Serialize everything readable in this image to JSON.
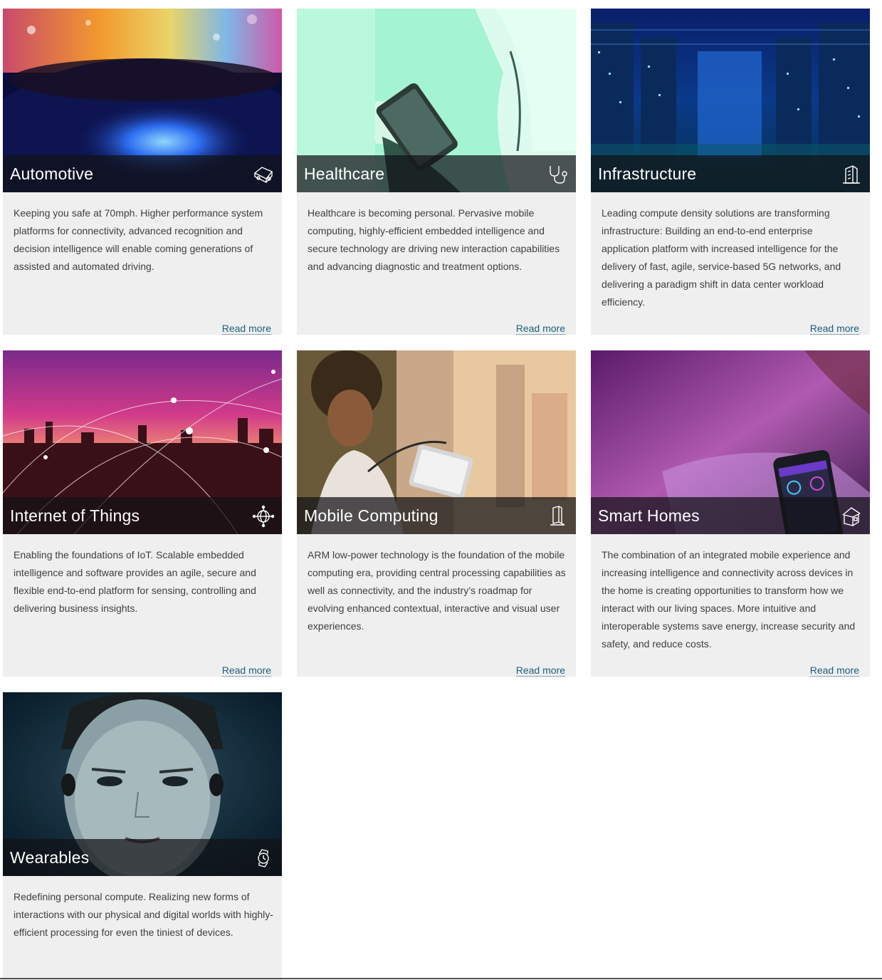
{
  "cards": [
    {
      "title": "Automotive",
      "description": "Keeping you safe at 70mph.  Higher performance system platforms for connectivity, advanced recognition and decision intelligence will enable coming generations of assisted and automated driving.",
      "link": "Read more",
      "icon": "car-icon"
    },
    {
      "title": "Healthcare",
      "description": "Healthcare is becoming personal. Pervasive mobile computing, highly-efficient embedded intelligence and secure technology are driving new interaction capabilities and advancing diagnostic and treatment options.",
      "link": "Read more",
      "icon": "stethoscope-icon"
    },
    {
      "title": "Infrastructure",
      "description": "Leading compute density solutions are transforming infrastructure: Building an end-to-end enterprise application platform with increased intelligence for the delivery of fast, agile, service-based 5G networks, and delivering a paradigm shift in data center workload efficiency.",
      "link": "Read more",
      "icon": "building-icon"
    },
    {
      "title": "Internet of Things",
      "description": "Enabling the foundations of IoT. Scalable embedded intelligence and software provides an agile, secure and flexible end-to-end platform for sensing, controlling and delivering business insights.",
      "link": "Read more",
      "icon": "globe-network-icon"
    },
    {
      "title": "Mobile Computing",
      "description": "ARM low-power technology is the foundation of the mobile computing era, providing central processing capabilities as well as connectivity, and the industry’s roadmap for evolving enhanced contextual, interactive and visual user experiences.",
      "link": "Read more",
      "icon": "phone-icon"
    },
    {
      "title": "Smart Homes",
      "description": "The combination of an integrated mobile experience and increasing intelligence and connectivity across devices in the home is creating opportunities to transform how we interact with our living spaces. More intuitive and interoperable systems save energy, increase security and safety, and reduce costs.",
      "link": "Read more",
      "icon": "house-icon"
    },
    {
      "title": "Wearables",
      "description": "Redefining personal compute. Realizing new forms of interactions with our physical and digital worlds with highly-efficient processing for even the tiniest of devices.",
      "link": "",
      "icon": "watch-icon"
    }
  ]
}
